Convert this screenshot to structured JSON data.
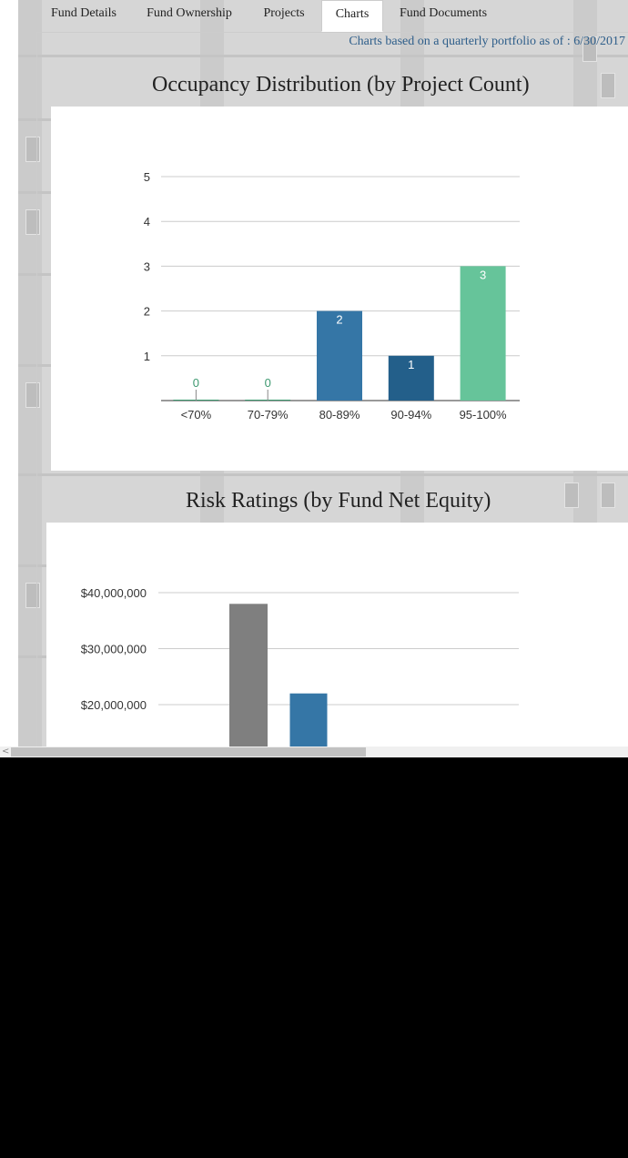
{
  "tabs": [
    {
      "label": "Fund Details"
    },
    {
      "label": "Fund Ownership"
    },
    {
      "label": "Projects"
    },
    {
      "label": "Charts",
      "active": true
    },
    {
      "label": "Fund Documents"
    }
  ],
  "as_of_text": "Charts based on a quarterly portfolio as of : 6/30/2017",
  "chart_data": [
    {
      "type": "bar",
      "title": "Occupancy Distribution (by Project Count)",
      "categories": [
        "<70%",
        "70-79%",
        "80-89%",
        "90-94%",
        "95-100%"
      ],
      "values": [
        0,
        0,
        2,
        1,
        3
      ],
      "colors": [
        "#3d9970",
        "#3d9970",
        "#3576a6",
        "#235f8a",
        "#66c49a"
      ],
      "ylim": [
        0,
        5
      ],
      "yticks": [
        "1",
        "2",
        "3",
        "4",
        "5"
      ],
      "grid": true,
      "data_labels": true
    },
    {
      "type": "bar",
      "title": "Risk Ratings (by Fund Net Equity)",
      "values": [
        38000000,
        22000000
      ],
      "colors": [
        "#7f7f7f",
        "#3576a6"
      ],
      "yticks": [
        "$20,000,000",
        "$30,000,000",
        "$40,000,000"
      ],
      "grid": true
    }
  ],
  "scrollbar": {
    "left_arrow": "<"
  }
}
